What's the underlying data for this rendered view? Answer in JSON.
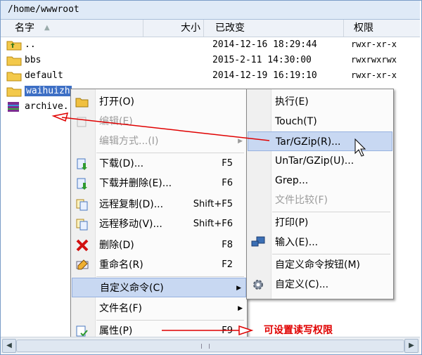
{
  "path": "/home/wwwroot",
  "columns": {
    "name": "名字",
    "size": "大小",
    "modified": "已改变",
    "perms": "权限"
  },
  "files": [
    {
      "name": "..",
      "date": "2014-12-16 18:29:44",
      "perms": "rwxr-xr-x",
      "icon": "folder-up-icon"
    },
    {
      "name": "bbs",
      "date": "2015-2-11 14:30:00",
      "perms": "rwxrwxrwx",
      "icon": "folder-icon"
    },
    {
      "name": "default",
      "date": "2014-12-19 16:19:10",
      "perms": "rwxr-xr-x",
      "icon": "folder-icon"
    },
    {
      "name": "waihuizh",
      "date": "",
      "perms": "",
      "icon": "folder-icon"
    },
    {
      "name": "archive.",
      "date": "",
      "perms": "",
      "icon": "archive-icon"
    }
  ],
  "menu": {
    "open": "打开(O)",
    "edit": "编辑(E)",
    "edit_with": "编辑方式...(I)",
    "download": "下载(D)...",
    "download_sc": "F5",
    "download_delete": "下载并删除(E)...",
    "download_delete_sc": "F6",
    "remote_copy": "远程复制(D)...",
    "remote_copy_sc": "Shift+F5",
    "remote_move": "远程移动(V)...",
    "remote_move_sc": "Shift+F6",
    "delete": "删除(D)",
    "delete_sc": "F8",
    "rename": "重命名(R)",
    "rename_sc": "F2",
    "custom_cmd": "自定义命令(C)",
    "filename": "文件名(F)",
    "properties": "属性(P)",
    "properties_sc": "F9"
  },
  "submenu": {
    "execute": "执行(E)",
    "touch": "Touch(T)",
    "targzip": "Tar/GZip(R)...",
    "untargzip": "UnTar/GZip(U)...",
    "grep": "Grep...",
    "compare": "文件比较(F)",
    "print": "打印(P)",
    "input": "输入(E)...",
    "custom_buttons": "自定义命令按钮(M)",
    "customize": "自定义(C)..."
  },
  "annotation": "可设置读写权限",
  "colors": {
    "selection": "#3d6fc5",
    "highlight": "#c8d8f2",
    "arrow": "#e00000"
  }
}
